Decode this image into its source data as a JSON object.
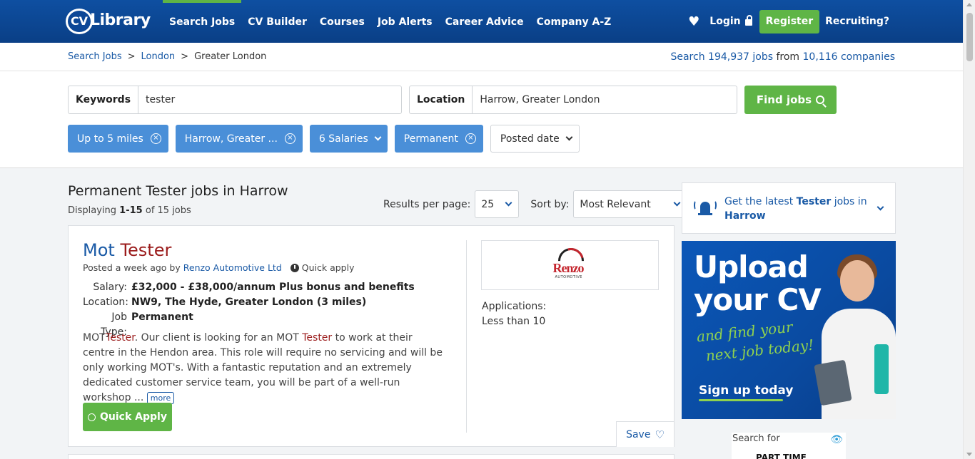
{
  "header": {
    "logo_cv": "CV",
    "logo_text": "Library",
    "nav": [
      "Search Jobs",
      "CV Builder",
      "Courses",
      "Job Alerts",
      "Career Advice",
      "Company A-Z"
    ],
    "login": "Login",
    "register": "Register",
    "recruiting": "Recruiting?"
  },
  "breadcrumb": {
    "items": [
      "Search Jobs",
      "London",
      "Greater London"
    ],
    "sep": ">",
    "count_prefix": "Search",
    "jobs_count": "194,937 jobs",
    "from": "from",
    "companies_count": "10,116 companies"
  },
  "search": {
    "keywords_label": "Keywords",
    "keywords_value": "tester",
    "location_label": "Location",
    "location_value": "Harrow, Greater London",
    "find_label": "Find jobs"
  },
  "filters": {
    "distance": "Up to 5 miles",
    "location": "Harrow, Greater ...",
    "salaries": "6 Salaries",
    "type": "Permanent",
    "posted": "Posted date",
    "close_glyph": "×"
  },
  "results": {
    "title": "Permanent Tester jobs in Harrow",
    "display_prefix": "Displaying",
    "display_range": "1-15",
    "display_suffix": "of 15 jobs",
    "per_page_label": "Results per page:",
    "per_page_value": "25",
    "sort_label": "Sort by:",
    "sort_value": "Most Relevant"
  },
  "job": {
    "title_prefix": "Mot",
    "title_highlight": "Tester",
    "posted": "Posted a week ago by",
    "company": "Renzo Automotive Ltd",
    "quick_apply_tag": "Quick apply",
    "salary_label": "Salary:",
    "salary": "£32,000 - £38,000/annum Plus bonus and benefits",
    "location_label": "Location:",
    "location": "NW9, The Hyde, Greater London (3 miles)",
    "type_label": "Job Type:",
    "type": "Permanent",
    "desc_1": "MOT",
    "desc_hl_1": "Tester",
    "desc_2": ". Our client is looking for an MOT",
    "desc_hl_2": "Tester",
    "desc_3": "to work at their centre in the Hendon area. This role will require no servicing and will be only working MOT's. With a fantastic reputation and an extremely dedicated customer service team, you will be part of a well-run workshop ...",
    "more": "more",
    "quick_apply_btn": "Quick Apply",
    "logo_word": "Renzo",
    "logo_sub": "AUTOMOTIVE",
    "applications_label": "Applications:",
    "applications_value": "Less than 10",
    "save": "Save"
  },
  "sidebar": {
    "alert_prefix": "Get the latest",
    "alert_keyword": "Tester",
    "alert_mid": "jobs in",
    "alert_location": "Harrow",
    "banner_line1": "Upload",
    "banner_line2": "your CV",
    "banner_script1": "and find your",
    "banner_script2": "next job today!",
    "banner_cta": "Sign up today",
    "ad_search_for": "Search for",
    "ad_text": "PART TIME"
  },
  "colors": {
    "brand_blue": "#0e4fa1",
    "accent_green": "#5fb546",
    "chip_blue": "#4a8fd8",
    "highlight_red": "#9b1c1c"
  }
}
